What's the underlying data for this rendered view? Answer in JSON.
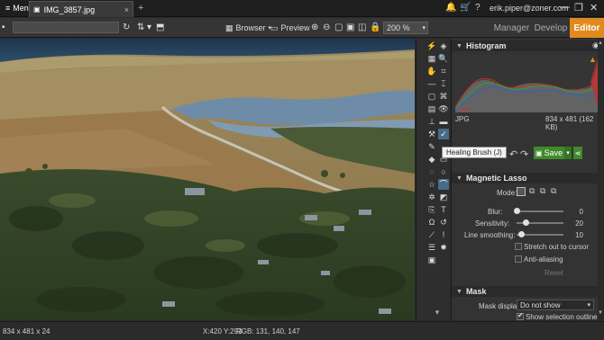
{
  "titlebar": {
    "menu_label": "Menu",
    "tab_title": "IMG_3857.jpg",
    "tab_close": "×",
    "new_tab": "+",
    "user_email": "erik.piper@zoner.com",
    "icons": [
      "bell-icon",
      "cart-icon",
      "help-icon",
      "user-icon"
    ],
    "minimize": "—",
    "restore": "❐",
    "close": "✕"
  },
  "toolbar": {
    "browser_label": "Browser",
    "preview_label": "Preview",
    "zoom_value": "200 %",
    "modes": [
      {
        "label": "Manager"
      },
      {
        "label": "Develop"
      },
      {
        "label": "Editor"
      }
    ]
  },
  "tooltip": "Healing Brush (J)",
  "histogram": {
    "title": "Histogram",
    "format": "JPG",
    "info": "834 x 481 (162 KB)"
  },
  "actions": {
    "save_label": "Save"
  },
  "magnetic_lasso": {
    "title": "Magnetic Lasso",
    "mode_label": "Mode:",
    "blur_label": "Blur:",
    "blur_value": "0",
    "blur_fraction": 0.0,
    "sensitivity_label": "Sensitivity:",
    "sensitivity_value": "20",
    "sensitivity_fraction": 0.2,
    "line_smoothing_label": "Line smoothing:",
    "line_smoothing_value": "10",
    "line_smoothing_fraction": 0.1,
    "stretch_label": "Stretch out to cursor",
    "anti_alias_label": "Anti-aliasing",
    "reset_label": "Reset"
  },
  "mask": {
    "title": "Mask",
    "display_label": "Mask display:",
    "display_value": "Do not show",
    "outline_label": "Show selection outline"
  },
  "status": {
    "dimensions": "834 x 481 x 24",
    "coords": "X:420 Y:293",
    "rgb": "RGB: 131, 140, 147"
  },
  "colors": {
    "accent": "#e08a1e",
    "save_green": "#3f8a2a"
  }
}
